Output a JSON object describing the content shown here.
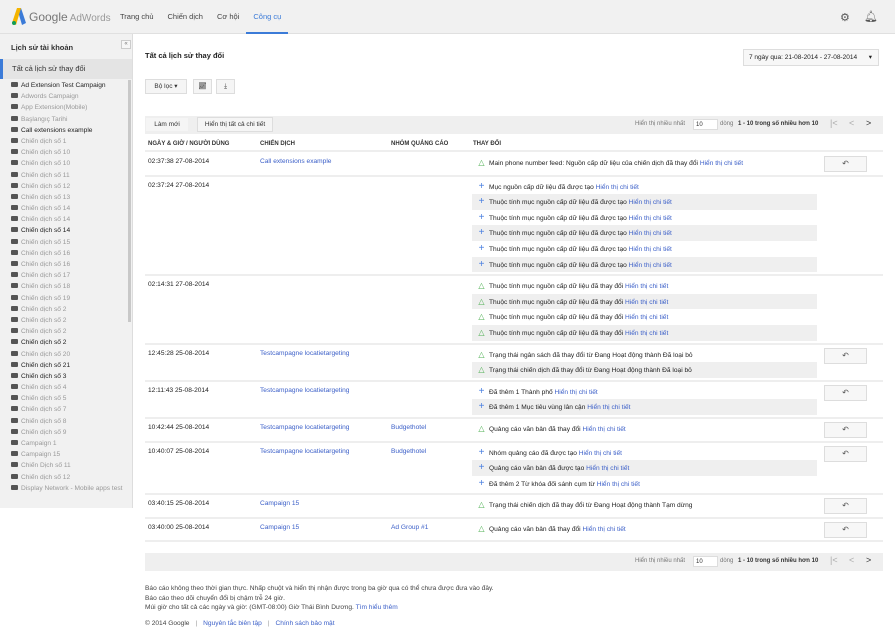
{
  "header": {
    "logo_google": "Google",
    "logo_adwords": "AdWords",
    "tabs": [
      {
        "label": "Trang chủ"
      },
      {
        "label": "Chiến dịch"
      },
      {
        "label": "Cơ hội"
      },
      {
        "label": "Công cụ",
        "active": true
      }
    ],
    "accent": "#3b7bd8"
  },
  "sidebar": {
    "title": "Lịch sử tài khoản",
    "collapse": "«",
    "all_label": "Tất cả lịch sử thay đổi",
    "items": [
      {
        "label": "Ad Extension Test Campaign",
        "dark": true
      },
      {
        "label": "Adwords Campaign"
      },
      {
        "label": "App Extension(Mobile)"
      },
      {
        "label": "Başlangıç Tarihi"
      },
      {
        "label": "Call extensions example",
        "dark": true
      },
      {
        "label": "Chiến dịch số 1"
      },
      {
        "label": "Chiến dịch số 10"
      },
      {
        "label": "Chiến dịch số 10"
      },
      {
        "label": "Chiến dịch số 11"
      },
      {
        "label": "Chiến dịch số 12"
      },
      {
        "label": "Chiến dịch số 13"
      },
      {
        "label": "Chiến dịch số 14"
      },
      {
        "label": "Chiến dịch số 14"
      },
      {
        "label": "Chiến dịch số 14",
        "dark": true
      },
      {
        "label": "Chiến dịch số 15"
      },
      {
        "label": "Chiến dịch số 16"
      },
      {
        "label": "Chiến dịch số 16"
      },
      {
        "label": "Chiến dịch số 17"
      },
      {
        "label": "Chiến dịch số 18"
      },
      {
        "label": "Chiến dịch số 19"
      },
      {
        "label": "Chiến dịch số 2"
      },
      {
        "label": "Chiến dịch số 2"
      },
      {
        "label": "Chiến dịch số 2"
      },
      {
        "label": "Chiến dịch số 2",
        "dark": true
      },
      {
        "label": "Chiến dịch số 20"
      },
      {
        "label": "Chiến dịch số 21",
        "dark": true
      },
      {
        "label": "Chiến dịch số 3",
        "dark": true
      },
      {
        "label": "Chiến dịch số 4"
      },
      {
        "label": "Chiến dịch số 5"
      },
      {
        "label": "Chiến dịch số 7"
      },
      {
        "label": "Chiến dịch số 8"
      },
      {
        "label": "Chiến dịch số 9"
      },
      {
        "label": "Campaign 1"
      },
      {
        "label": "Campaign 15"
      },
      {
        "label": "Chiến Dịch số 11"
      },
      {
        "label": "Chiến dịch số 12"
      },
      {
        "label": "Display Network - Mobile apps test"
      }
    ]
  },
  "main": {
    "title": "Tất cả lịch sử thay đổi",
    "date_range": "7 ngày qua: 21-08-2014 - 27-08-2014",
    "filter_label": "Bộ lọc ▾",
    "refresh_label": "Làm mới",
    "show_all_details_label": "Hiển thị tất cả chi tiết"
  },
  "pager": {
    "show_label": "Hiển thị nhiều nhất",
    "rows_value": "10",
    "rows_label": "dòng",
    "range": "1 - 10 trong số nhiều hơn 10"
  },
  "table": {
    "headers": [
      "NGÀY & GIỜ / NGƯỜI DÙNG",
      "CHIẾN DỊCH",
      "NHÓM QUẢNG CÁO",
      "THAY ĐỔI"
    ],
    "detail_link": "Hiển thị chi tiết",
    "rows": [
      {
        "time": "02:37:38 27-08-2014",
        "campaign": "Call extensions example",
        "adgroup": "",
        "undo": true,
        "changes": [
          {
            "type": "changed",
            "text": "Main phone number feed: Nguồn cấp dữ liệu của chiến dịch đã thay đổi",
            "details": true
          }
        ]
      },
      {
        "time": "02:37:24 27-08-2014",
        "campaign": "",
        "adgroup": "",
        "undo": false,
        "changes": [
          {
            "type": "added",
            "text": "Mục nguồn cấp dữ liệu đã được tạo",
            "details": true
          },
          {
            "type": "added",
            "text": "Thuộc tính mục nguồn cấp dữ liệu đã được tạo",
            "details": true
          },
          {
            "type": "added",
            "text": "Thuộc tính mục nguồn cấp dữ liệu đã được tạo",
            "details": true
          },
          {
            "type": "added",
            "text": "Thuộc tính mục nguồn cấp dữ liệu đã được tạo",
            "details": true
          },
          {
            "type": "added",
            "text": "Thuộc tính mục nguồn cấp dữ liệu đã được tạo",
            "details": true
          },
          {
            "type": "added",
            "text": "Thuộc tính mục nguồn cấp dữ liệu đã được tạo",
            "details": true
          }
        ]
      },
      {
        "time": "02:14:31 27-08-2014",
        "campaign": "",
        "adgroup": "",
        "undo": false,
        "changes": [
          {
            "type": "changed",
            "text": "Thuộc tính mục nguồn cấp dữ liệu đã thay đổi",
            "details": true
          },
          {
            "type": "changed",
            "text": "Thuộc tính mục nguồn cấp dữ liệu đã thay đổi",
            "details": true
          },
          {
            "type": "changed",
            "text": "Thuộc tính mục nguồn cấp dữ liệu đã thay đổi",
            "details": true
          },
          {
            "type": "changed",
            "text": "Thuộc tính mục nguồn cấp dữ liệu đã thay đổi",
            "details": true
          }
        ]
      },
      {
        "time": "12:45:28 25-08-2014",
        "campaign": "Testcampagne locatietargeting",
        "adgroup": "",
        "undo": true,
        "changes": [
          {
            "type": "changed",
            "text": "Trạng thái ngân sách đã thay đổi từ Đang Hoạt động thành Đã loại bỏ",
            "details": false
          },
          {
            "type": "changed",
            "text": "Trạng thái chiến dịch đã thay đổi từ Đang Hoạt động thành Đã loại bỏ",
            "details": false
          }
        ]
      },
      {
        "time": "12:11:43 25-08-2014",
        "campaign": "Testcampagne locatietargeting",
        "adgroup": "",
        "undo": true,
        "changes": [
          {
            "type": "added",
            "text": "Đã thêm 1 Thành phố",
            "details": true
          },
          {
            "type": "added",
            "text": "Đã thêm 1 Mục tiêu vùng lân cận",
            "details": true
          }
        ]
      },
      {
        "time": "10:42:44 25-08-2014",
        "campaign": "Testcampagne locatietargeting",
        "adgroup": "Budgethotel",
        "undo": true,
        "changes": [
          {
            "type": "changed",
            "text": "Quảng cáo văn bản đã thay đổi",
            "details": true
          }
        ]
      },
      {
        "time": "10:40:07 25-08-2014",
        "campaign": "Testcampagne locatietargeting",
        "adgroup": "Budgethotel",
        "undo": true,
        "changes": [
          {
            "type": "added",
            "text": "Nhóm quảng cáo đã được tạo",
            "details": true
          },
          {
            "type": "added",
            "text": "Quảng cáo văn bản đã được tạo",
            "details": true
          },
          {
            "type": "added",
            "text": "Đã thêm 2 Từ khóa đối sánh cụm từ",
            "details": true
          }
        ]
      },
      {
        "time": "03:40:15 25-08-2014",
        "campaign": "Campaign 15",
        "adgroup": "",
        "undo": true,
        "changes": [
          {
            "type": "changed",
            "text": "Trạng thái chiến dịch đã thay đổi từ Đang Hoạt động thành Tạm dừng",
            "details": false
          }
        ]
      },
      {
        "time": "03:40:00 25-08-2014",
        "campaign": "Campaign 15",
        "adgroup": "Ad Group #1",
        "undo": true,
        "changes": [
          {
            "type": "changed",
            "text": "Quảng cáo văn bản đã thay đổi",
            "details": true
          }
        ]
      }
    ]
  },
  "footer": {
    "line1": "Báo cáo không theo thời gian thực. Nhấp chuột và hiển thị nhận được trong ba giờ qua có thể chưa được đưa vào đây.",
    "line2": "Báo cáo theo dõi chuyển đổi bị chậm trễ 24 giờ.",
    "line3": "Múi giờ cho tất cả các ngày và giờ: (GMT-08:00) Giờ Thái Bình Dương.",
    "learn_more": "Tìm hiểu thêm",
    "copyright": "© 2014 Google",
    "editorial": "Nguyên tắc biên tập",
    "privacy": "Chính sách bảo mật"
  }
}
